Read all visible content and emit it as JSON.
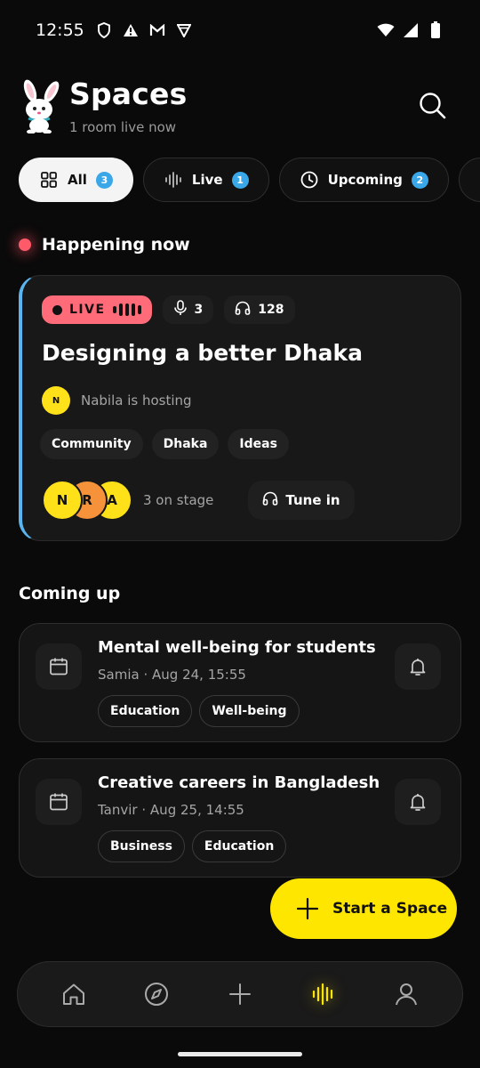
{
  "status_bar": {
    "time": "12:55"
  },
  "header": {
    "title": "Spaces",
    "subtitle": "1 room live now"
  },
  "filters": [
    {
      "label": "All",
      "count": "3",
      "icon": "grid-icon"
    },
    {
      "label": "Live",
      "count": "1",
      "icon": "waveform-icon"
    },
    {
      "label": "Upcoming",
      "count": "2",
      "icon": "clock-icon"
    }
  ],
  "happening": {
    "heading": "Happening now"
  },
  "live_space": {
    "badge": "LIVE",
    "speakers": "3",
    "listeners": "128",
    "title": "Designing a better Dhaka",
    "host_initial": "N",
    "host_text": "Nabila is hosting",
    "tags": [
      "Community",
      "Dhaka",
      "Ideas"
    ],
    "stage": [
      {
        "initial": "N",
        "color": "#ffe11a"
      },
      {
        "initial": "R",
        "color": "#f5923a"
      },
      {
        "initial": "A",
        "color": "#ffe11a"
      }
    ],
    "stage_text": "3 on stage",
    "tune_in": "Tune in"
  },
  "coming_up": {
    "heading": "Coming up",
    "items": [
      {
        "title": "Mental well-being for students",
        "host": "Samia",
        "date": "Aug 24, 15:55",
        "tags": [
          "Education",
          "Well-being"
        ]
      },
      {
        "title": "Creative careers in Bangladesh",
        "host": "Tanvir",
        "date": "Aug 25, 14:55",
        "tags": [
          "Business",
          "Education"
        ]
      }
    ]
  },
  "fab": {
    "label": "Start a Space"
  },
  "nav": [
    "home-icon",
    "compass-icon",
    "plus-icon",
    "spaces-icon",
    "profile-icon"
  ],
  "colors": {
    "accent": "#ffe600",
    "live": "#ff6b78",
    "badge": "#3aa7e8",
    "live_border": "#5ab4f0"
  }
}
